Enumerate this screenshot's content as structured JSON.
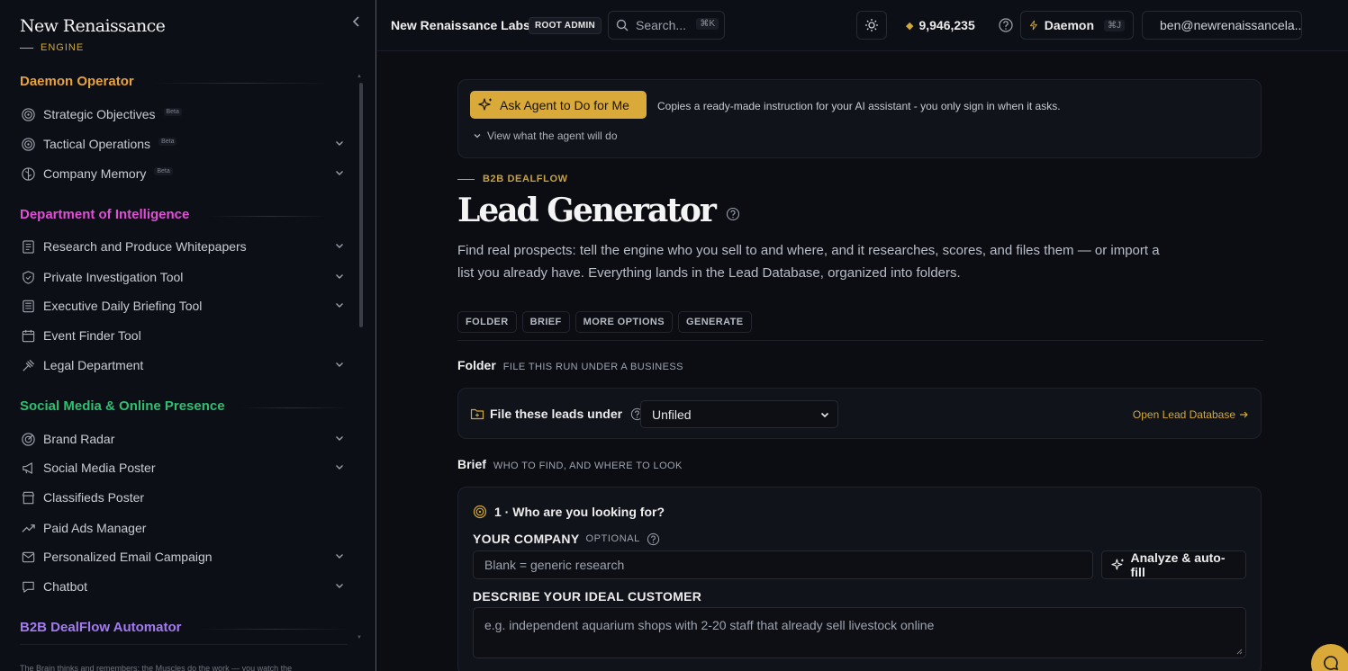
{
  "brand": {
    "name": "New Renaissance",
    "sub": "ENGINE"
  },
  "sidebar": {
    "sections": [
      {
        "title": "Daemon Operator",
        "color": "#e8a33a",
        "items": [
          {
            "label": "Strategic Objectives",
            "icon": "target-icon",
            "beta": "Beta",
            "chevron": false
          },
          {
            "label": "Tactical Operations",
            "icon": "target-icon",
            "beta": "Beta",
            "chevron": true
          },
          {
            "label": "Company Memory",
            "icon": "brain-icon",
            "beta": "Beta",
            "chevron": true
          }
        ]
      },
      {
        "title": "Department of Intelligence",
        "color": "#e04fd6",
        "items": [
          {
            "label": "Research and Produce Whitepapers",
            "icon": "document-icon",
            "chevron": true
          },
          {
            "label": "Private Investigation Tool",
            "icon": "shield-icon",
            "chevron": true
          },
          {
            "label": "Executive Daily Briefing Tool",
            "icon": "newspaper-icon",
            "chevron": true
          },
          {
            "label": "Event Finder Tool",
            "icon": "calendar-icon",
            "chevron": false
          },
          {
            "label": "Legal Department",
            "icon": "gavel-icon",
            "chevron": true
          }
        ]
      },
      {
        "title": "Social Media & Online Presence",
        "color": "#2fbf71",
        "items": [
          {
            "label": "Brand Radar",
            "icon": "radar-icon",
            "chevron": true
          },
          {
            "label": "Social Media Poster",
            "icon": "megaphone-icon",
            "chevron": true
          },
          {
            "label": "Classifieds Poster",
            "icon": "store-icon",
            "chevron": false
          },
          {
            "label": "Paid Ads Manager",
            "icon": "trending-up-icon",
            "chevron": false
          },
          {
            "label": "Personalized Email Campaign",
            "icon": "mail-icon",
            "chevron": true
          },
          {
            "label": "Chatbot",
            "icon": "chat-icon",
            "chevron": true
          }
        ]
      },
      {
        "title": "B2B DealFlow Automator",
        "color": "#a37bf0",
        "items": []
      }
    ],
    "footer": "The Brain thinks and remembers; the Muscles do the work — you watch the"
  },
  "topbar": {
    "org": "New Renaissance Labs",
    "role": "ROOT ADMIN",
    "search_placeholder": "Search...",
    "search_kbd": "⌘K",
    "credits": "9,946,235",
    "daemon_label": "Daemon",
    "daemon_kbd": "⌘J",
    "user_email": "ben@newrenaissancela..."
  },
  "agent": {
    "button": "Ask Agent to Do for Me",
    "description": "Copies a ready-made instruction for your AI assistant - you only sign in when it asks.",
    "view": "View what the agent will do"
  },
  "page": {
    "eyebrow": "B2B DEALFLOW",
    "title": "Lead Generator",
    "intro": "Find real prospects: tell the engine who you sell to and where, and it researches, scores, and files them — or import a list you already have. Everything lands in the Lead Database, organized into folders.",
    "tabs": [
      "FOLDER",
      "BRIEF",
      "MORE OPTIONS",
      "GENERATE"
    ]
  },
  "folder": {
    "title": "Folder",
    "subtitle": "FILE THIS RUN UNDER A BUSINESS",
    "label": "File these leads under",
    "selected": "Unfiled",
    "open_db": "Open Lead Database"
  },
  "brief": {
    "title": "Brief",
    "subtitle": "WHO TO FIND, AND WHERE TO LOOK",
    "question": "1 · Who are you looking for?",
    "company_label": "YOUR COMPANY",
    "company_optional": "OPTIONAL",
    "company_placeholder": "Blank = generic research",
    "analyze_button": "Analyze & auto-fill",
    "customer_label": "DESCRIBE YOUR IDEAL CUSTOMER",
    "customer_placeholder": "e.g. independent aquarium shops with 2-20 staff that already sell livestock online"
  },
  "colors": {
    "accent": "#d9aa39",
    "background": "#0b0d13",
    "panel": "#11131b"
  }
}
